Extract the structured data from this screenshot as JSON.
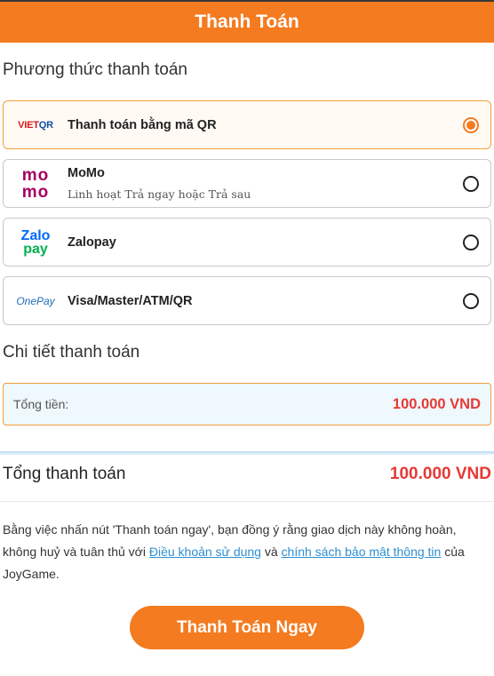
{
  "header": {
    "title": "Thanh Toán"
  },
  "payment_methods_section": {
    "title": "Phương thức thanh toán"
  },
  "methods": [
    {
      "name": "Thanh toán bằng mã QR",
      "subtitle": "",
      "logo_text_a": "VIET",
      "logo_text_b": "QR",
      "selected": true
    },
    {
      "name": "MoMo",
      "subtitle": "Linh hoạt Trả ngay hoặc Trả sau",
      "logo_text_a": "mo",
      "logo_text_b": "mo",
      "selected": false
    },
    {
      "name": "Zalopay",
      "subtitle": "",
      "logo_text_a": "Zalo",
      "logo_text_b": "pay",
      "selected": false
    },
    {
      "name": "Visa/Master/ATM/QR",
      "subtitle": "",
      "logo_text_a": "OnePay",
      "selected": false
    }
  ],
  "details_section": {
    "title": "Chi tiết thanh toán"
  },
  "details": {
    "label": "Tổng tiền:",
    "value": "100.000 VND"
  },
  "total": {
    "label": "Tổng thanh toán",
    "value": "100.000 VND"
  },
  "terms": {
    "prefix": "Bằng việc nhấn nút 'Thanh toán ngay', bạn đồng ý rằng giao dịch này không hoàn, không huỷ và tuân thủ với",
    "link_terms": "Điều khoản sử dụng",
    "and": "và",
    "link_privacy": "chính sách bảo mật thông tin",
    "suffix": "của JoyGame."
  },
  "pay_button": {
    "label": "Thanh Toán Ngay"
  },
  "colors": {
    "accent": "#f47b20",
    "price": "#e53935",
    "link": "#2f8fd1"
  }
}
